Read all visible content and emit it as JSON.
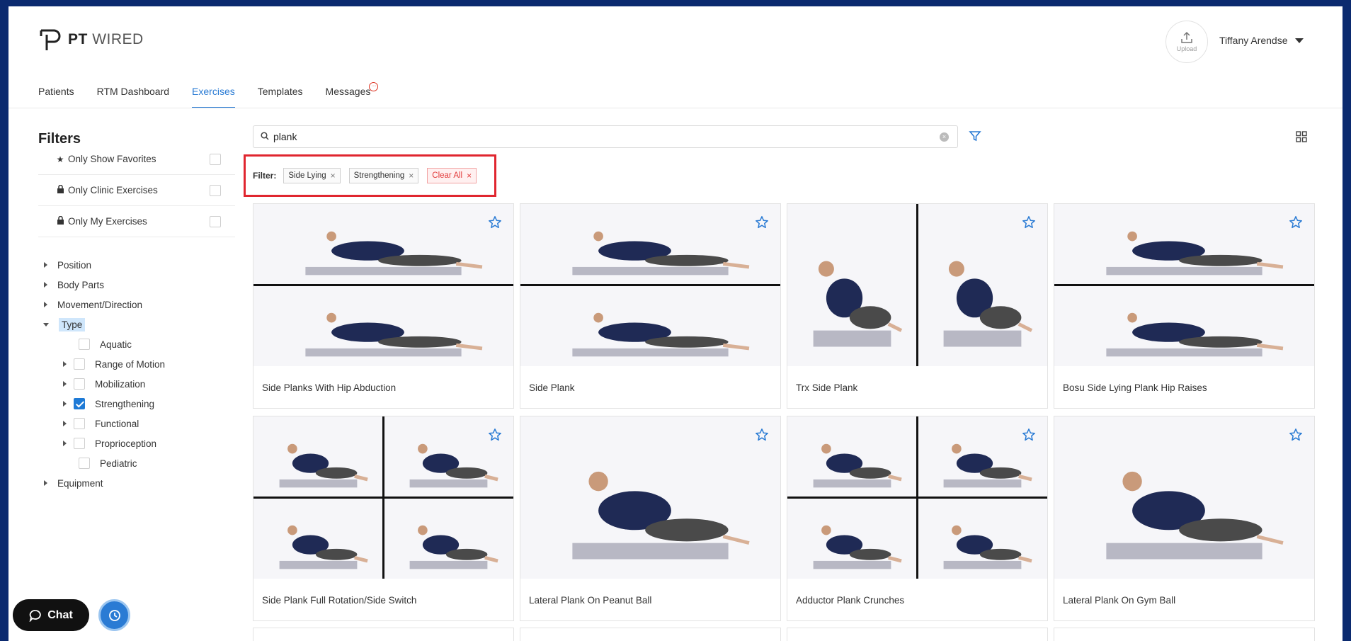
{
  "brand": {
    "name_bold": "PT",
    "name_rest": "WIRED"
  },
  "header": {
    "upload_label": "Upload",
    "user_name": "Tiffany Arendse"
  },
  "tabs": [
    {
      "label": "Patients"
    },
    {
      "label": "RTM Dashboard"
    },
    {
      "label": "Exercises",
      "active": true
    },
    {
      "label": "Templates"
    },
    {
      "label": "Messages",
      "badge": "···"
    }
  ],
  "sidebar": {
    "title": "Filters",
    "options": [
      {
        "label": "Only Show Favorites",
        "icon": "star-icon",
        "checked": false
      },
      {
        "label": "Only Clinic Exercises",
        "icon": "lock-icon",
        "checked": false
      },
      {
        "label": "Only My Exercises",
        "icon": "lock-icon",
        "checked": false
      }
    ],
    "tree": [
      {
        "label": "Position"
      },
      {
        "label": "Body Parts"
      },
      {
        "label": "Movement/Direction"
      },
      {
        "label": "Type",
        "expanded": true
      },
      {
        "label": "Aquatic",
        "checked": false
      },
      {
        "label": "Range of Motion",
        "checked": false
      },
      {
        "label": "Mobilization",
        "checked": false
      },
      {
        "label": "Strengthening",
        "checked": true
      },
      {
        "label": "Functional",
        "checked": false
      },
      {
        "label": "Proprioception",
        "checked": false
      },
      {
        "label": "Pediatric",
        "checked": false
      },
      {
        "label": "Equipment"
      }
    ]
  },
  "search": {
    "value": "plank",
    "clear_glyph": "×"
  },
  "filter_bar": {
    "label": "Filter:",
    "chips": [
      "Side Lying",
      "Strengthening"
    ],
    "clear_all": "Clear All",
    "remove_glyph": "×"
  },
  "exercises": [
    {
      "title": "Side Planks With Hip Abduction"
    },
    {
      "title": "Side Plank"
    },
    {
      "title": "Trx Side Plank"
    },
    {
      "title": "Bosu Side Lying Plank Hip Raises"
    },
    {
      "title": "Side Plank Full Rotation/Side Switch"
    },
    {
      "title": "Lateral Plank On Peanut Ball"
    },
    {
      "title": "Adductor Plank Crunches"
    },
    {
      "title": "Lateral Plank On Gym Ball"
    }
  ],
  "floating": {
    "chat_label": "Chat"
  },
  "colors": {
    "accent": "#2a7bd4",
    "highlight_border": "#e0262f",
    "page_bg": "#0b2a6f"
  }
}
